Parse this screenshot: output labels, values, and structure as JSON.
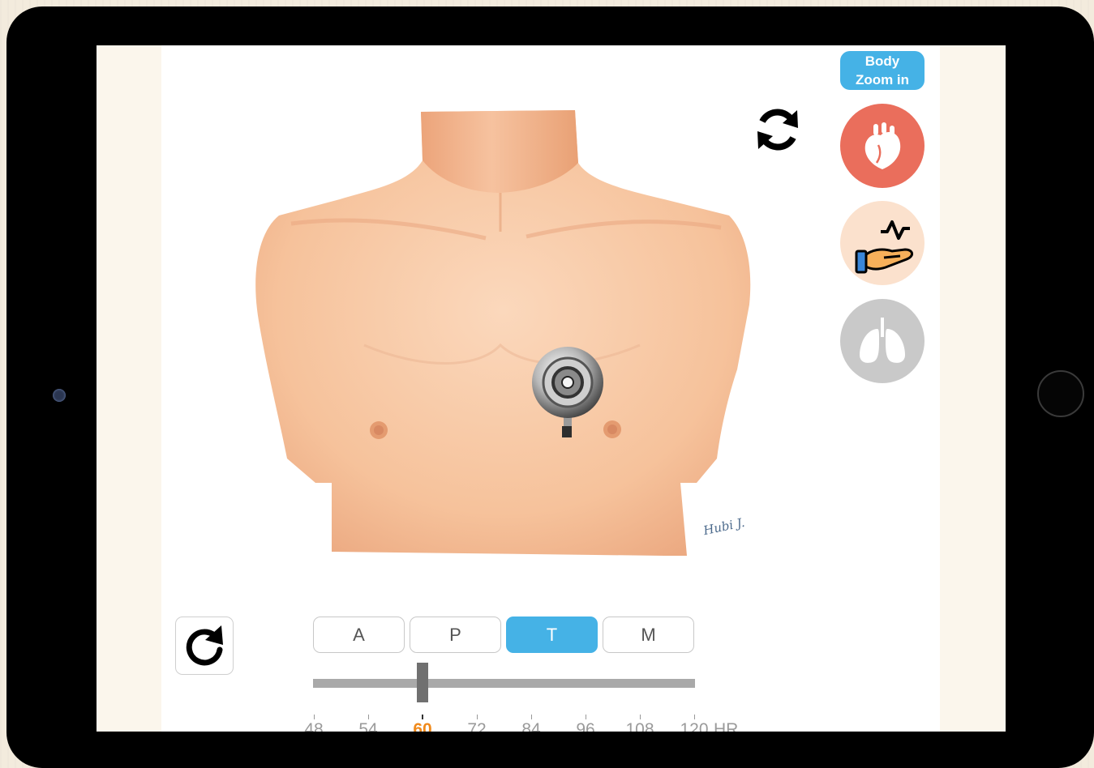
{
  "app": {
    "zoom_badge": {
      "line1": "Body",
      "line2": "Zoom in"
    },
    "signature": "Hubi J.",
    "modes": [
      {
        "name": "heart",
        "icon": "heart-icon",
        "color": "#ea6e5c"
      },
      {
        "name": "pulse",
        "icon": "pulse-hand-icon",
        "color": "#fbe1cd"
      },
      {
        "name": "lungs",
        "icon": "lungs-icon",
        "color": "#c9c9c9"
      }
    ],
    "segments": [
      {
        "label": "A",
        "active": false
      },
      {
        "label": "P",
        "active": false
      },
      {
        "label": "T",
        "active": true
      },
      {
        "label": "M",
        "active": false
      }
    ],
    "heart_rate": {
      "ticks": [
        "48",
        "54",
        "60",
        "72",
        "84",
        "96",
        "108",
        "120"
      ],
      "unit": "HR",
      "selected": "60"
    },
    "colors": {
      "accent": "#45b2e6",
      "selected_tick": "#f08a1c",
      "heart_mode": "#ea6e5c"
    }
  }
}
